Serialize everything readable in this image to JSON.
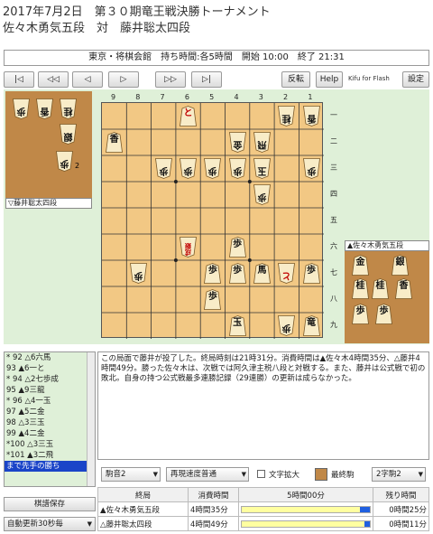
{
  "header": {
    "line1": "2017年7月2日　第３０期竜王戦決勝トーナメント",
    "line2": "佐々木勇気五段　対　藤井聡太四段"
  },
  "infobar": "東京・将棋会館　持ち時間:各5時間　開始 10:00　終了 21:31",
  "toolbar": {
    "first": "|◁",
    "back10": "◁◁",
    "back": "◁",
    "fwd": "▷",
    "fwd10": "▷▷",
    "last": "▷|",
    "flip": "反転",
    "help": "Help",
    "kff": "Kifu for Flash",
    "settings": "設定"
  },
  "file_labels": [
    "9",
    "8",
    "7",
    "6",
    "5",
    "4",
    "3",
    "2",
    "1"
  ],
  "rank_labels": [
    "一",
    "二",
    "三",
    "四",
    "五",
    "六",
    "七",
    "八",
    "九"
  ],
  "gote_hand": {
    "label": "▽藤井聡太四段",
    "pieces": [
      {
        "name": "pawn",
        "ch": "歩",
        "count": ""
      },
      {
        "name": "lance",
        "ch": "香",
        "count": ""
      },
      {
        "name": "knight",
        "ch": "桂",
        "count": ""
      },
      {
        "name": "silver",
        "ch": "銀",
        "count": ""
      },
      {
        "name": "pawn2",
        "ch": "歩",
        "count": "2"
      }
    ]
  },
  "sente_hand": {
    "label": "▲佐々木勇気五段",
    "pieces": [
      {
        "name": "gold",
        "ch": "金",
        "count": ""
      },
      {
        "name": "silver",
        "ch": "銀",
        "count": ""
      },
      {
        "name": "knight",
        "ch": "桂",
        "count": ""
      },
      {
        "name": "knight2",
        "ch": "桂",
        "count": ""
      },
      {
        "name": "lance",
        "ch": "香",
        "count": ""
      },
      {
        "name": "pawn",
        "ch": "歩",
        "count": ""
      },
      {
        "name": "pawn2",
        "ch": "歩",
        "count": ""
      }
    ]
  },
  "board": [
    {
      "file": 2,
      "rank": 1,
      "ch": "桂",
      "side": "gote"
    },
    {
      "file": 1,
      "rank": 1,
      "ch": "香",
      "side": "gote"
    },
    {
      "file": 6,
      "rank": 1,
      "ch": "と",
      "side": "sente",
      "prom": true
    },
    {
      "file": 9,
      "rank": 2,
      "ch": "香",
      "side": "sente"
    },
    {
      "file": 4,
      "rank": 2,
      "ch": "金",
      "side": "gote"
    },
    {
      "file": 3,
      "rank": 2,
      "ch": "飛",
      "side": "gote"
    },
    {
      "file": 7,
      "rank": 3,
      "ch": "歩",
      "side": "gote"
    },
    {
      "file": 6,
      "rank": 3,
      "ch": "歩",
      "side": "gote"
    },
    {
      "file": 5,
      "rank": 3,
      "ch": "歩",
      "side": "gote"
    },
    {
      "file": 4,
      "rank": 3,
      "ch": "歩",
      "side": "gote"
    },
    {
      "file": 3,
      "rank": 3,
      "ch": "玉",
      "side": "gote"
    },
    {
      "file": 1,
      "rank": 3,
      "ch": "歩",
      "side": "gote"
    },
    {
      "file": 3,
      "rank": 4,
      "ch": "歩",
      "side": "gote"
    },
    {
      "file": 6,
      "rank": 6,
      "ch": "成銀",
      "side": "gote",
      "prom": true
    },
    {
      "file": 4,
      "rank": 6,
      "ch": "歩",
      "side": "sente"
    },
    {
      "file": 8,
      "rank": 7,
      "ch": "歩",
      "side": "gote"
    },
    {
      "file": 5,
      "rank": 7,
      "ch": "歩",
      "side": "sente"
    },
    {
      "file": 4,
      "rank": 7,
      "ch": "歩",
      "side": "sente"
    },
    {
      "file": 3,
      "rank": 7,
      "ch": "馬",
      "side": "sente"
    },
    {
      "file": 2,
      "rank": 7,
      "ch": "と",
      "side": "gote",
      "prom": true
    },
    {
      "file": 1,
      "rank": 7,
      "ch": "歩",
      "side": "sente"
    },
    {
      "file": 5,
      "rank": 8,
      "ch": "歩",
      "side": "sente"
    },
    {
      "file": 4,
      "rank": 9,
      "ch": "玉",
      "side": "sente"
    },
    {
      "file": 2,
      "rank": 9,
      "ch": "歩",
      "side": "gote"
    },
    {
      "file": 1,
      "rank": 9,
      "ch": "竜",
      "side": "sente"
    }
  ],
  "moves": [
    "* 92 △6六馬",
    "  93 ▲6一と",
    "* 94 △2七歩成",
    "  95 ▲9三龍",
    "* 96 △4一玉",
    "  97 ▲5二金",
    "  98 △3三玉",
    "  99 ▲4二金",
    "*100 △3三玉",
    "*101 ▲3二飛",
    "まで先手の勝ち"
  ],
  "comment": "この局面で藤井が投了した。終局時刻は21時31分。消費時間は▲佐々木4時間35分、△藤井4時間49分。勝った佐々木は、次戦では阿久津主税八段と対戦する。また、藤井は公式戦で初の敗北。自身の持つ公式戦最多連勝記録（29連勝）の更新は成らなかった。",
  "controls": {
    "piece_sound": "駒音2",
    "speed": "再現速度普通",
    "zoom_text": "文字拡大",
    "last_move": "最終駒",
    "font_style": "2字駒2",
    "save": "棋譜保存",
    "autoplay": "自動更新30秒毎"
  },
  "clock": {
    "header": [
      "終局",
      "消費時間",
      "5時間00分",
      "残り時間"
    ],
    "rows": [
      {
        "player": "▲佐々木勇気五段",
        "used": "4時間35分",
        "remaining": "0時間25分",
        "fraction": 0.92
      },
      {
        "player": "△藤井聡太四段",
        "used": "4時間49分",
        "remaining": "0時間11分",
        "fraction": 0.96
      }
    ]
  }
}
